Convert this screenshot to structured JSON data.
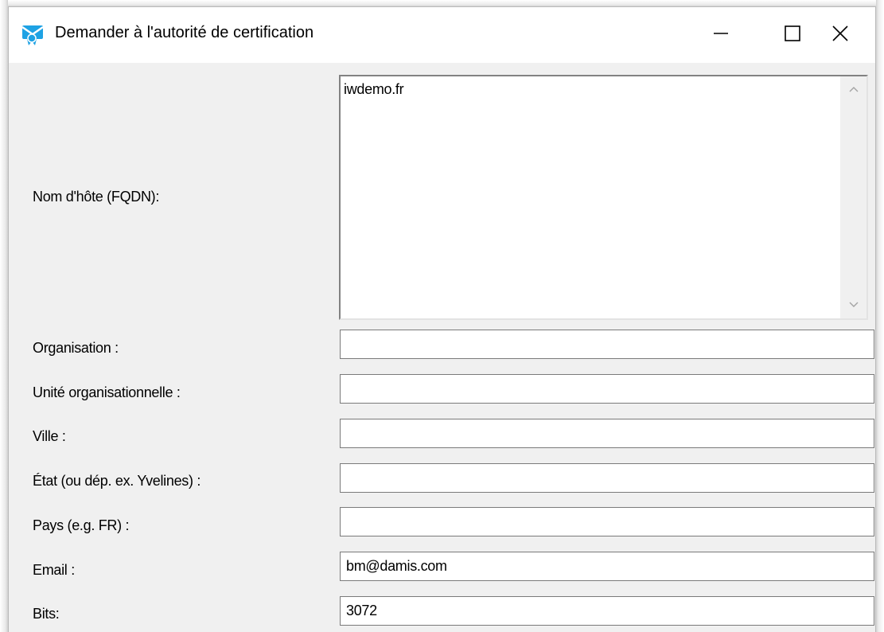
{
  "window": {
    "title": "Demander à l'autorité de certification",
    "icon": "certificate-app-icon",
    "controls": {
      "minimize_icon": "minimize-icon",
      "maximize_icon": "maximize-icon",
      "close_icon": "close-icon"
    }
  },
  "form": {
    "hostname": {
      "label": "Nom d'hôte (FQDN):",
      "value": "iwdemo.fr"
    },
    "organisation": {
      "label": "Organisation :",
      "value": ""
    },
    "org_unit": {
      "label": "Unité organisationnelle :",
      "value": ""
    },
    "city": {
      "label": "Ville :",
      "value": ""
    },
    "state": {
      "label": "État (ou dép. ex. Yvelines) :",
      "value": ""
    },
    "country": {
      "label": "Pays (e.g. FR) :",
      "value": ""
    },
    "email": {
      "label": "Email :",
      "value": "bm@damis.com"
    },
    "bits": {
      "label": "Bits:",
      "value": "3072"
    }
  },
  "colors": {
    "icon_accent": "#1ea2e4",
    "window_bg": "#f0f0f0",
    "field_border": "#7a7a7a"
  }
}
